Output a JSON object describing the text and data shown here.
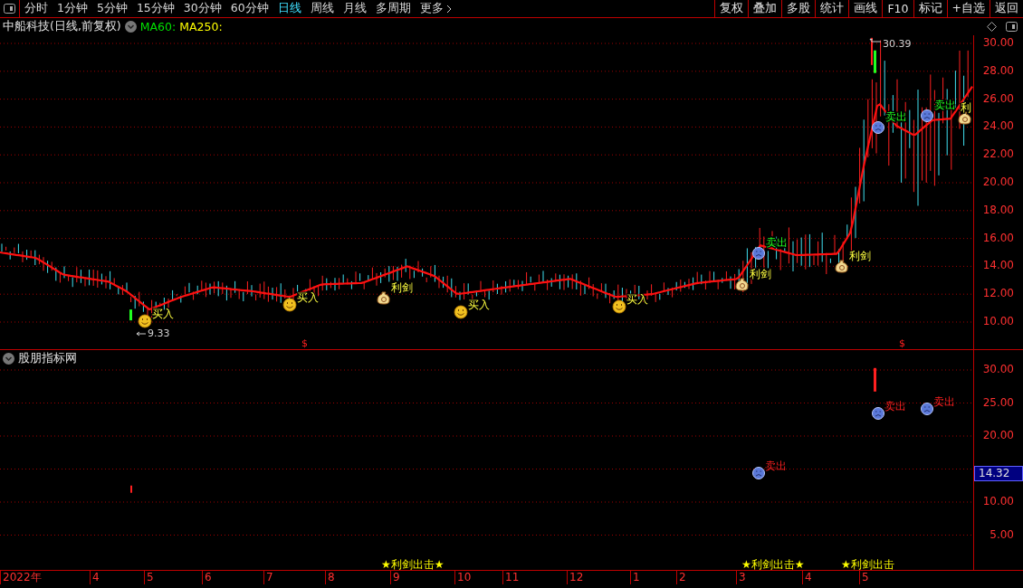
{
  "toolbar": {
    "periods": [
      {
        "label": "分时",
        "selected": false
      },
      {
        "label": "1分钟",
        "selected": false
      },
      {
        "label": "5分钟",
        "selected": false
      },
      {
        "label": "15分钟",
        "selected": false
      },
      {
        "label": "30分钟",
        "selected": false
      },
      {
        "label": "60分钟",
        "selected": false
      },
      {
        "label": "日线",
        "selected": true
      },
      {
        "label": "周线",
        "selected": false
      },
      {
        "label": "月线",
        "selected": false
      },
      {
        "label": "多周期",
        "selected": false
      },
      {
        "label": "更多",
        "selected": false
      }
    ],
    "actions": [
      "复权",
      "叠加",
      "多股",
      "统计",
      "画线",
      "F10",
      "标记",
      "+自选",
      "返回"
    ]
  },
  "legend": {
    "title": "中船科技(日线,前复权)",
    "averages": [
      {
        "label": "MA60:",
        "color": "#00e000"
      },
      {
        "label": "MA250:",
        "color": "#ffff00"
      }
    ]
  },
  "price_chart": {
    "axis": [
      "30.00",
      "28.00",
      "26.00",
      "24.00",
      "22.00",
      "20.00",
      "18.00",
      "16.00",
      "14.00",
      "12.00",
      "10.00"
    ],
    "high": "30.39",
    "low": "9.33",
    "signals": [
      {
        "kind": "buy",
        "label": "买入"
      },
      {
        "kind": "buy",
        "label": "买入"
      },
      {
        "kind": "sword",
        "label": "利剑"
      },
      {
        "kind": "buy",
        "label": "买入"
      },
      {
        "kind": "buy",
        "label": "买入"
      },
      {
        "kind": "sword",
        "label": "利剑"
      },
      {
        "kind": "sell",
        "label": "卖出"
      },
      {
        "kind": "sword",
        "label": "利剑"
      },
      {
        "kind": "sell",
        "label": "卖出"
      },
      {
        "kind": "sell",
        "label": "卖出"
      },
      {
        "kind": "sword",
        "label": "利"
      }
    ],
    "markers": [
      "$",
      "$"
    ]
  },
  "indicator": {
    "title": "股朋指标网",
    "axis": [
      "30.00",
      "25.00",
      "20.00",
      "10.00",
      "5.00"
    ],
    "current": "14.32",
    "signals": [
      {
        "kind": "sell",
        "label": "卖出"
      },
      {
        "kind": "sell",
        "label": "卖出"
      },
      {
        "kind": "sell",
        "label": "卖出"
      }
    ],
    "events": [
      "★利剑出击★",
      "★利剑出击★",
      "★利剑出击"
    ]
  },
  "dates": [
    "2022年",
    "4",
    "5",
    "6",
    "7",
    "8",
    "9",
    "10",
    "11",
    "12",
    "1",
    "2",
    "3",
    "4",
    "5"
  ]
}
